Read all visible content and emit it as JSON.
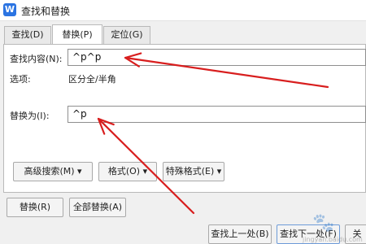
{
  "window": {
    "title": "查找和替换",
    "icon": "W"
  },
  "tabs": [
    {
      "label": "查找(D)"
    },
    {
      "label": "替换(P)"
    },
    {
      "label": "定位(G)"
    }
  ],
  "find": {
    "label": "查找内容(N):",
    "value": "^p^p"
  },
  "options": {
    "label": "选项:",
    "value": "区分全/半角"
  },
  "replace": {
    "label": "替换为(I):",
    "value": "^p"
  },
  "buttons": {
    "advanced": "高级搜索(M) ▾",
    "format": "格式(O) ▾",
    "special": "特殊格式(E) ▾",
    "replace": "替换(R)",
    "replace_all": "全部替换(A)",
    "find_prev": "查找上一处(B)",
    "find_next": "查找下一处(F)",
    "close_partial": "关"
  },
  "annotation": {
    "color": "#d81e1e"
  },
  "watermark": {
    "text": "jingyan.baidu.com"
  }
}
